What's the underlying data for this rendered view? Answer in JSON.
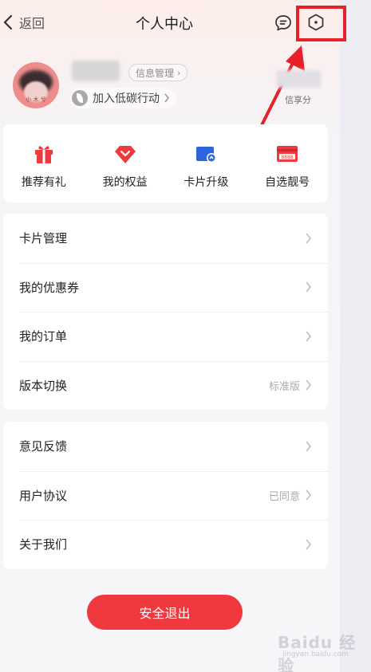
{
  "header": {
    "back_label": "返回",
    "title": "个人中心"
  },
  "profile": {
    "info_tag": "信息管理",
    "low_carbon": "加入低碳行动",
    "score_label": "信享分",
    "avatar_caption": "小 木 兮"
  },
  "quick_actions": [
    {
      "label": "推荐有礼",
      "icon": "gift-icon"
    },
    {
      "label": "我的权益",
      "icon": "gem-icon"
    },
    {
      "label": "卡片升级",
      "icon": "card-upgrade-icon"
    },
    {
      "label": "自选靓号",
      "icon": "number-card-icon"
    }
  ],
  "menu_group_1": [
    {
      "label": "卡片管理",
      "value": ""
    },
    {
      "label": "我的优惠券",
      "value": ""
    },
    {
      "label": "我的订单",
      "value": ""
    },
    {
      "label": "版本切换",
      "value": "标准版"
    }
  ],
  "menu_group_2": [
    {
      "label": "意见反馈",
      "value": ""
    },
    {
      "label": "用户协议",
      "value": "已同意"
    },
    {
      "label": "关于我们",
      "value": ""
    }
  ],
  "logout_label": "安全退出",
  "watermark": {
    "text": "Baidu 经验",
    "sub": "jingyan.baidu.com"
  },
  "colors": {
    "accent": "#f0383f",
    "highlight": "#e8202a",
    "blue_icon": "#2f64e0"
  }
}
